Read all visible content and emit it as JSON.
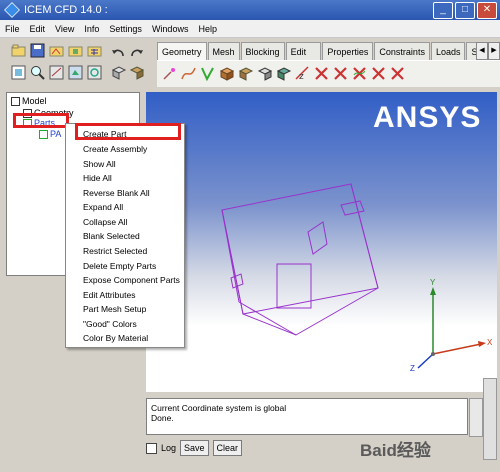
{
  "window": {
    "title": "ICEM CFD 14.0 :",
    "controls": [
      "_",
      "□",
      "✕"
    ]
  },
  "menubar": {
    "items": [
      "File",
      "Edit",
      "View",
      "Info",
      "Settings",
      "Windows",
      "Help"
    ]
  },
  "tabs": {
    "items": [
      "Geometry",
      "Mesh",
      "Blocking",
      "Edit Mesh",
      "Properties",
      "Constraints",
      "Loads",
      "Solve O"
    ],
    "active": "Geometry",
    "nav_prev": "◀",
    "nav_next": "▶"
  },
  "model_tree": {
    "root": "Model",
    "geometry": "Geometry",
    "parts": "Parts",
    "parts_child": "PA"
  },
  "context_menu": {
    "items": [
      "Create Part",
      "Create Assembly",
      "Show All",
      "Hide All",
      "Reverse Blank All",
      "Expand All",
      "Collapse All",
      "Blank Selected",
      "Restrict Selected",
      "Delete Empty Parts",
      "Expose Component Parts",
      "Edit Attributes",
      "Part Mesh Setup",
      "\"Good\" Colors",
      "Color By Material"
    ]
  },
  "viewport": {
    "logo": "ANSYS",
    "axis_labels": {
      "x": "X",
      "y": "Y",
      "z": "Z"
    }
  },
  "log": {
    "lines": [
      "Current Coordinate system is global",
      "Done."
    ],
    "checkbox_label": "Log",
    "save_label": "Save",
    "clear_label": "Clear"
  },
  "watermark": "Baid经验",
  "colors": {
    "highlight_box": "#e02020",
    "viewport_top": "#315ec6",
    "model_wireframe": "#9933cc"
  }
}
